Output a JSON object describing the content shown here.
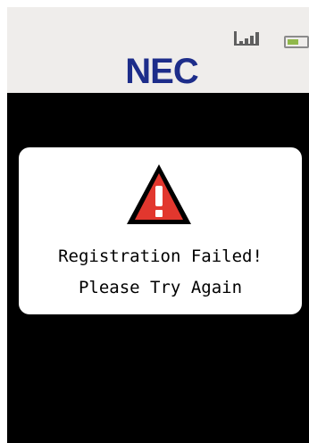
{
  "status_bar": {
    "brand": "NEC",
    "icons": [
      "signal-icon",
      "battery-icon"
    ],
    "background_color": "#efedeb"
  },
  "dialog": {
    "icon": "warning-icon",
    "title": "Registration Failed!",
    "message": "Please Try Again"
  },
  "colors": {
    "brand": "#1d2d8a",
    "screen_background": "#000000",
    "card_background": "#ffffff",
    "warning": "#e2372e",
    "battery_level": "#90b84b"
  }
}
